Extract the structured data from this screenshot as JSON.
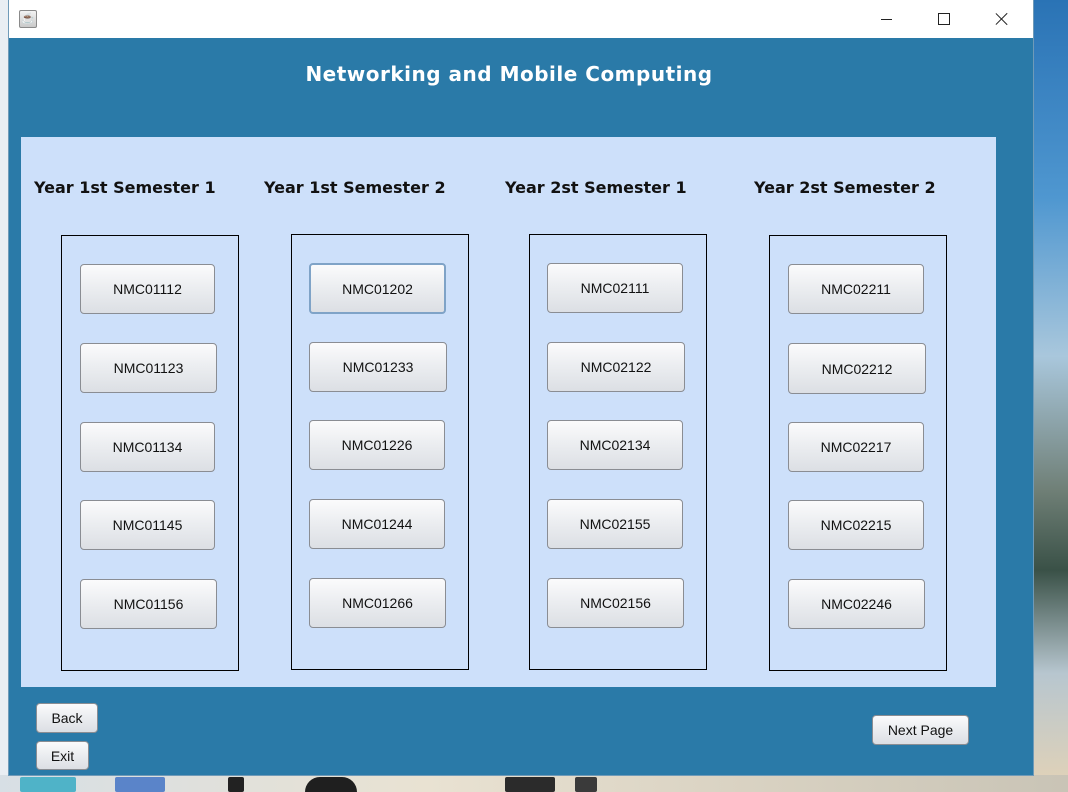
{
  "window": {
    "title": "",
    "title_icon": "java-cup-icon"
  },
  "header": {
    "title": "Networking and Mobile Computing"
  },
  "semesters": [
    {
      "label": "Year 1st Semester 1",
      "courses": [
        "NMC01112",
        "NMC01123",
        "NMC01134",
        "NMC01145",
        "NMC01156"
      ]
    },
    {
      "label": "Year 1st Semester 2",
      "courses": [
        "NMC01202",
        "NMC01233",
        "NMC01226",
        "NMC01244",
        "NMC01266"
      ]
    },
    {
      "label": "Year 2st Semester 1",
      "courses": [
        "NMC02111",
        "NMC02122",
        "NMC02134",
        "NMC02155",
        "NMC02156"
      ]
    },
    {
      "label": "Year 2st Semester 2",
      "courses": [
        "NMC02211",
        "NMC02212",
        "NMC02217",
        "NMC02215",
        "NMC02246"
      ]
    }
  ],
  "footer": {
    "back_label": "Back",
    "exit_label": "Exit",
    "next_label": "Next Page"
  },
  "colors": {
    "window_bg": "#2a7aa8",
    "panel_bg": "#cde0fa",
    "title_text": "#ffffff"
  }
}
